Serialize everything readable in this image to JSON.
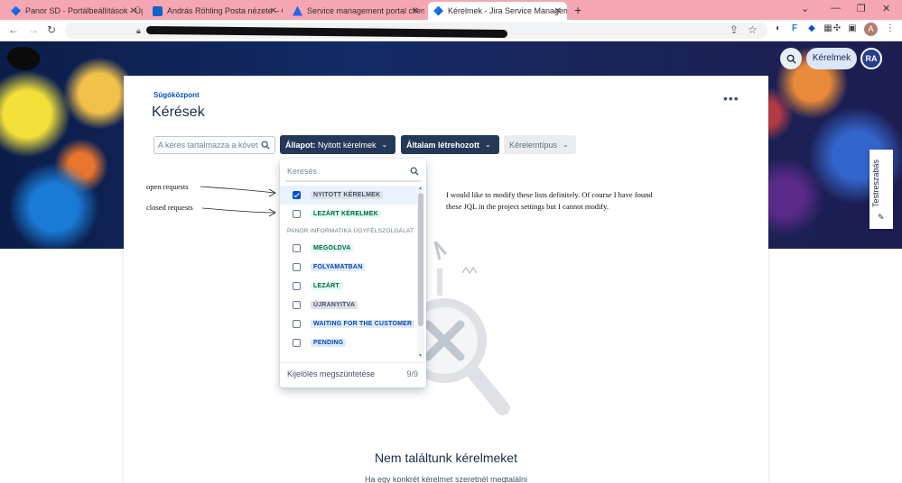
{
  "browser": {
    "tabs": [
      {
        "title": "Panor SD - Portálbeállítások - Üg",
        "icon": "jira-icon",
        "active": false
      },
      {
        "title": "András Röhling Posta nézete – C",
        "icon": "outlook-icon",
        "active": false
      },
      {
        "title": "Service management portal client",
        "icon": "atlassian-icon",
        "active": false
      },
      {
        "title": "Kérelmek - Jira Service Managem",
        "icon": "jira-icon",
        "active": true
      }
    ],
    "new_tab": "+",
    "profile_initial": "A"
  },
  "header": {
    "requests_button": "Kérelmek",
    "avatar_initials": "RA"
  },
  "feedback_tab": {
    "label": "Testreszabás"
  },
  "main": {
    "breadcrumb": "Súgóközpont",
    "title": "Kérések",
    "more_label": "•••",
    "search": {
      "placeholder": "A kérés tartalmazza a követ"
    },
    "filters": {
      "status_key": "Állapot:",
      "status_value": " Nyitott kérelmek",
      "created_by": "Általam létrehozott",
      "request_type": "Kérelemtípus"
    },
    "empty": {
      "title": "Nem találtunk kérelmeket",
      "subtitle": "Ha egy konkrét kérelmet szeretnél megtalálni"
    }
  },
  "dropdown": {
    "search_placeholder": "Keresés",
    "items": [
      {
        "label": "NYITOTT KÉRELMEK",
        "checked": true,
        "style": "grey"
      },
      {
        "label": "LEZÁRT KÉRELMEK",
        "checked": false,
        "style": "green"
      }
    ],
    "group_label": "PANOR INFORMATIKA ÜGYFÉLSZOLGÁLAT",
    "group_items": [
      {
        "label": "MEGOLDVA",
        "checked": false,
        "style": "green"
      },
      {
        "label": "FOLYAMATBAN",
        "checked": false,
        "style": "blue"
      },
      {
        "label": "LEZÁRT",
        "checked": false,
        "style": "green"
      },
      {
        "label": "ÚJRANYITVA",
        "checked": false,
        "style": "grey"
      },
      {
        "label": "WAITING FOR THE CUSTOMER",
        "checked": false,
        "style": "blue"
      },
      {
        "label": "PENDING",
        "checked": false,
        "style": "blue"
      }
    ],
    "clear_label": "Kijelölés megszüntetése",
    "count": "9/9"
  },
  "annotations": {
    "open_requests": "open requests",
    "closed_requests": "closed requests",
    "note": "I would like to modify these lists definitely. Of course I have found these JQL in the project settings but I cannot modify."
  },
  "colors": {
    "primary": "#0052cc",
    "dark_button": "#253858",
    "tab_bar": "#f4a7b3"
  }
}
